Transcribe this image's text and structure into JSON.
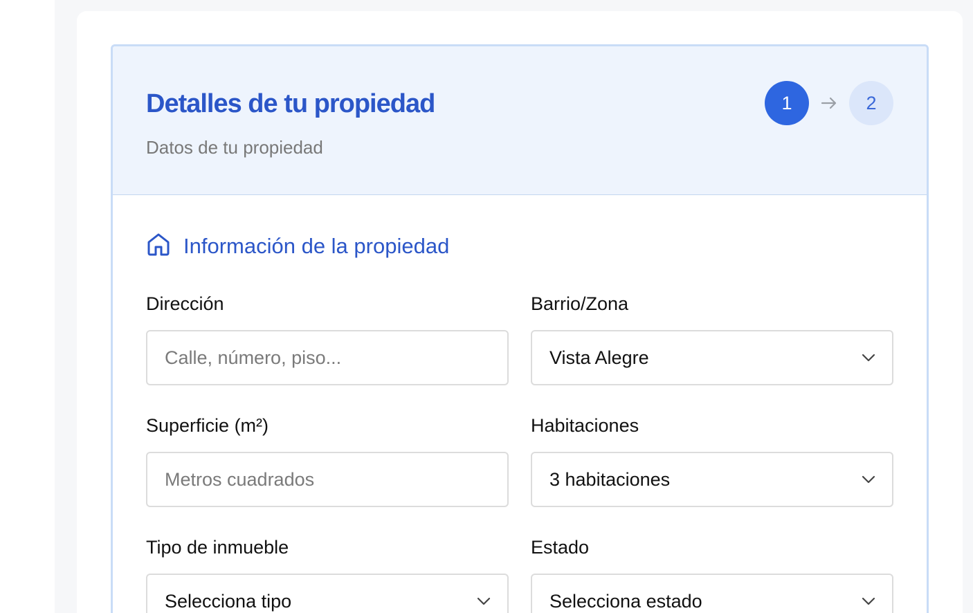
{
  "header": {
    "title": "Detalles de tu propiedad",
    "subtitle": "Datos de tu propiedad",
    "steps": [
      "1",
      "2"
    ],
    "current_step": 1
  },
  "section": {
    "title": "Información de la propiedad",
    "icon": "home-icon"
  },
  "fields": {
    "direccion": {
      "label": "Dirección",
      "placeholder": "Calle, número, piso...",
      "value": ""
    },
    "barrio": {
      "label": "Barrio/Zona",
      "value": "Vista Alegre"
    },
    "superficie": {
      "label": "Superficie (m²)",
      "placeholder": "Metros cuadrados",
      "value": ""
    },
    "habitaciones": {
      "label": "Habitaciones",
      "value": "3 habitaciones"
    },
    "tipo": {
      "label": "Tipo de inmueble",
      "value": "Selecciona tipo"
    },
    "estado": {
      "label": "Estado",
      "value": "Selecciona estado"
    }
  },
  "colors": {
    "accent": "#2b56c8",
    "step_active": "#2e66e0",
    "step_inactive": "#dbe6fa",
    "header_bg": "#eef4fd"
  }
}
